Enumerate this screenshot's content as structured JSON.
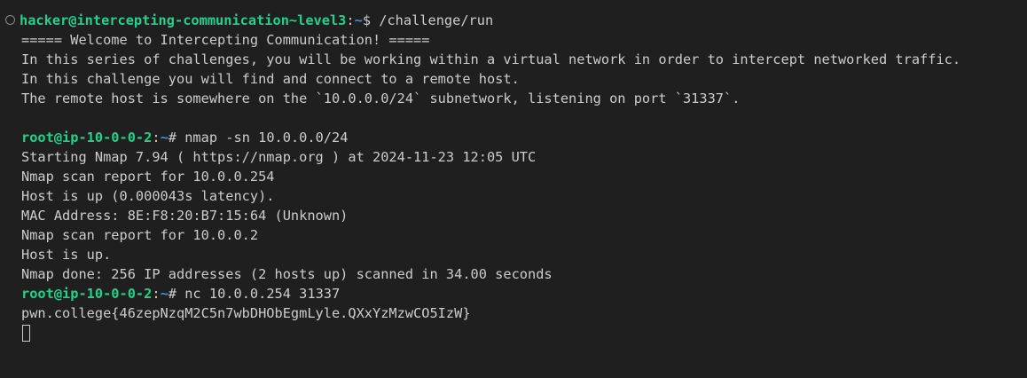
{
  "first_prompt": {
    "user_host": "hacker@intercepting-communication~level3",
    "colon": ":",
    "path": "~",
    "symbol": "$",
    "command": " /challenge/run"
  },
  "intro_lines": [
    "===== Welcome to Intercepting Communication! =====",
    "In this series of challenges, you will be working within a virtual network in order to intercept networked traffic.",
    "In this challenge you will find and connect to a remote host.",
    "The remote host is somewhere on the `10.0.0.0/24` subnetwork, listening on port `31337`."
  ],
  "nmap_prompt": {
    "user_host": "root@ip-10-0-0-2",
    "colon": ":",
    "path": "~",
    "symbol": "#",
    "command": " nmap -sn 10.0.0.0/24"
  },
  "nmap_output": [
    "Starting Nmap 7.94 ( https://nmap.org ) at 2024-11-23 12:05 UTC",
    "Nmap scan report for 10.0.0.254",
    "Host is up (0.000043s latency).",
    "MAC Address: 8E:F8:20:B7:15:64 (Unknown)",
    "Nmap scan report for 10.0.0.2",
    "Host is up.",
    "Nmap done: 256 IP addresses (2 hosts up) scanned in 34.00 seconds"
  ],
  "nc_prompt": {
    "user_host": "root@ip-10-0-0-2",
    "colon": ":",
    "path": "~",
    "symbol": "#",
    "command": " nc 10.0.0.254 31337"
  },
  "flag_line": "pwn.college{46zepNzqM2C5n7wbDHObEgmLyle.QXxYzMzwCO5IzW}",
  "colors": {
    "background": "#1f1f1f",
    "text": "#cccccc",
    "user_host": "#23d18b",
    "path": "#3b8eea"
  }
}
